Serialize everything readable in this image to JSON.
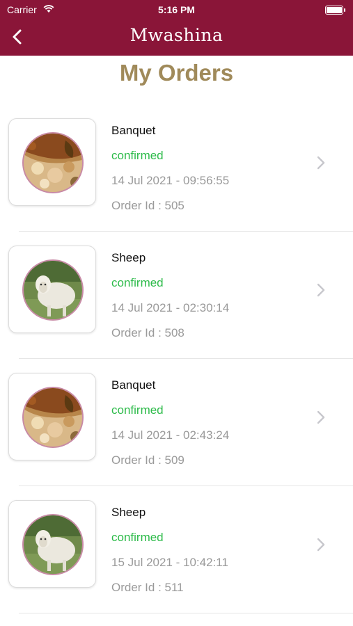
{
  "status_bar": {
    "carrier": "Carrier",
    "time": "5:16 PM"
  },
  "nav": {
    "title": "Mwashina",
    "back_icon": "chevron-left-icon"
  },
  "page_title": "My Orders",
  "colors": {
    "brand": "#8a1538",
    "title_gold": "#a08a5a",
    "confirmed_green": "#2dbb4a"
  },
  "orders": [
    {
      "name": "Banquet",
      "status": "confirmed",
      "date": "14 Jul 2021 - 09:56:55",
      "order_id": "Order Id : 505",
      "image": "banquet-food"
    },
    {
      "name": "Sheep",
      "status": "confirmed",
      "date": "14 Jul 2021 - 02:30:14",
      "order_id": "Order Id : 508",
      "image": "sheep"
    },
    {
      "name": "Banquet",
      "status": "confirmed",
      "date": "14 Jul 2021 - 02:43:24",
      "order_id": "Order Id : 509",
      "image": "banquet-food"
    },
    {
      "name": "Sheep",
      "status": "confirmed",
      "date": "15 Jul 2021 - 10:42:11",
      "order_id": "Order Id : 511",
      "image": "sheep"
    }
  ]
}
